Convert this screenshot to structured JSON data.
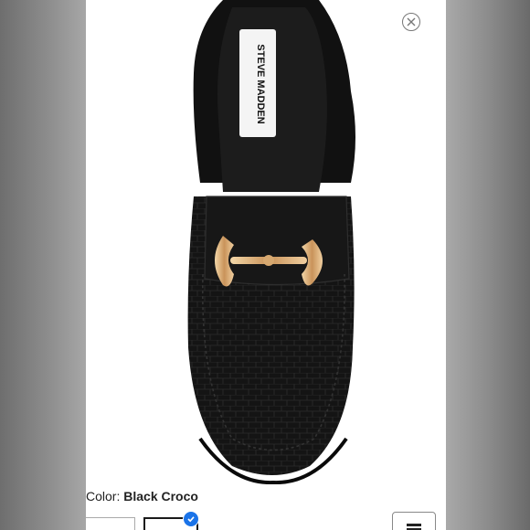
{
  "close": {
    "icon": "close-icon"
  },
  "product": {
    "brand_label": "STEVE MADDEN",
    "image_alt": "Black croco loafer mule"
  },
  "color": {
    "label": "Color:",
    "value": "Black Croco"
  },
  "swatches": [
    {
      "name": "swatch-1",
      "selected": false
    },
    {
      "name": "swatch-2",
      "selected": true
    }
  ],
  "colors": {
    "accent": "#1a73e8",
    "text": "#222222"
  }
}
